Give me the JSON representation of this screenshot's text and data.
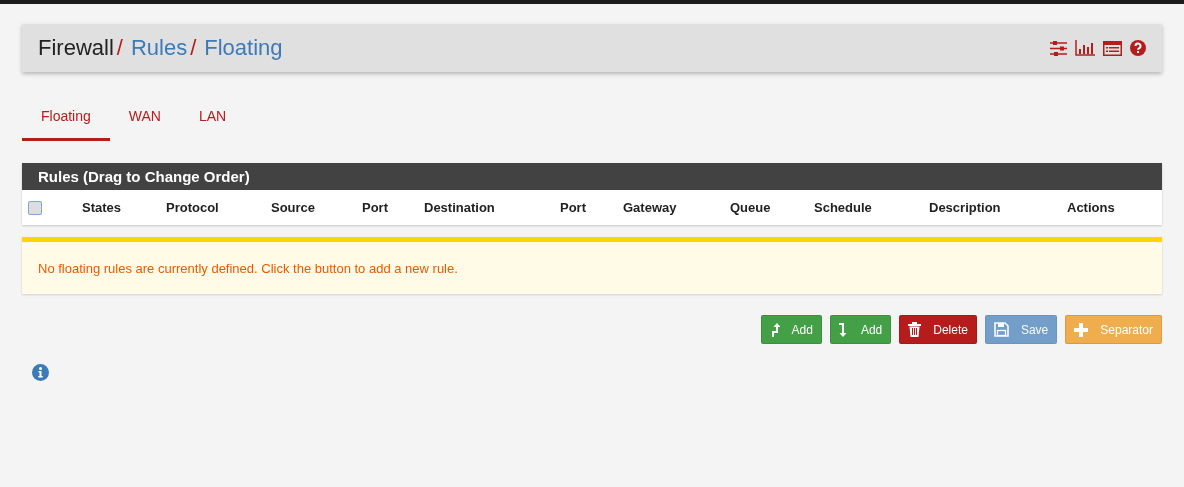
{
  "breadcrumb": [
    {
      "label": "Firewall",
      "kind": "plain",
      "separator": "/"
    },
    {
      "label": "Rules",
      "kind": "link",
      "separator": "/"
    },
    {
      "label": "Floating",
      "kind": "link"
    }
  ],
  "header_icons": [
    {
      "kind": "sliders"
    },
    {
      "kind": "chart"
    },
    {
      "kind": "list"
    },
    {
      "kind": "help"
    }
  ],
  "tabs": [
    {
      "label": "Floating",
      "selected": true
    },
    {
      "label": "WAN",
      "selected": false
    },
    {
      "label": "LAN",
      "selected": false
    }
  ],
  "table": {
    "title": "Rules (Drag to Change Order)",
    "select_all": {
      "checked": false
    },
    "columns": [
      "States",
      "Protocol",
      "Source",
      "Port",
      "Destination",
      "Port",
      "Gateway",
      "Queue",
      "Schedule",
      "Description",
      "Actions"
    ]
  },
  "alert": "No floating rules are currently defined. Click the button to add a new rule.",
  "buttons": [
    {
      "label": "Add",
      "kind": "add-top",
      "disabled": false
    },
    {
      "label": "Add",
      "kind": "add-bottom",
      "disabled": false
    },
    {
      "label": "Delete",
      "kind": "delete",
      "disabled": false
    },
    {
      "label": "Save",
      "kind": "save",
      "disabled": true
    },
    {
      "label": "Separator",
      "kind": "separator",
      "disabled": false
    }
  ]
}
